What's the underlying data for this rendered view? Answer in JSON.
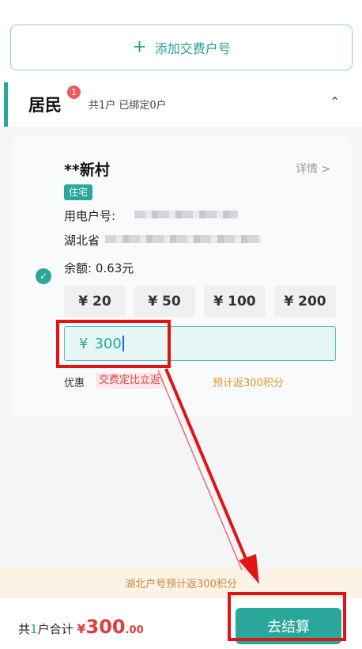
{
  "add_button": {
    "plus": "+",
    "label": "添加交费户号"
  },
  "section": {
    "title": "居民",
    "badge": "1",
    "summary": "共1户 已绑定0户",
    "collapse_icon": "chevron-up-icon"
  },
  "account": {
    "name": "**新村",
    "details_label": "详情 >",
    "type_tag": "住宅",
    "account_no_label": "用电户号:",
    "address_prefix": "湖北省",
    "balance_label": "余额:",
    "balance_value": "0.63元",
    "amount_options": [
      "¥ 20",
      "¥ 50",
      "¥ 100",
      "¥ 200"
    ],
    "custom_currency": "¥",
    "custom_value": "300",
    "promo_label": "优惠",
    "promo_tag": "交费定比立返",
    "promo_points": "预计返300积分"
  },
  "notice": "湖北户号预计返300积分",
  "footer": {
    "total_prefix": "共",
    "total_count": "1",
    "total_middle": "户合计",
    "currency": "¥",
    "amount": "300",
    "cents": ".00",
    "pay_label": "去结算"
  },
  "colors": {
    "accent": "#2aa79b",
    "price": "#e03c3c",
    "highlight": "#e01414",
    "promo_orange": "#e0962a"
  }
}
